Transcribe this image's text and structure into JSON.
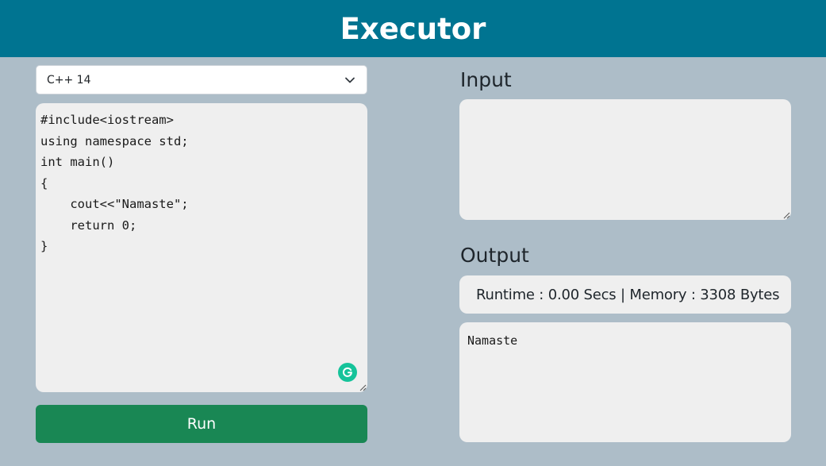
{
  "header": {
    "title": "Executor"
  },
  "language_select": {
    "selected": "C++ 14"
  },
  "code_editor": {
    "value": "#include<iostream>\nusing namespace std;\nint main()\n{\n    cout<<\"Namaste\";\n    return 0;\n}"
  },
  "run_button": {
    "label": "Run"
  },
  "input_section": {
    "title": "Input",
    "value": ""
  },
  "output_section": {
    "title": "Output",
    "stats": "Runtime : 0.00 Secs | Memory : 3308 Bytes",
    "value": "Namaste"
  },
  "icons": {
    "chevron": "chevron-down-icon",
    "grammarly": "grammarly-icon",
    "resize": "resize-grip-icon"
  },
  "colors": {
    "header_bg": "#007491",
    "page_bg": "#adbdc8",
    "run_button_bg": "#198754",
    "panel_bg": "#efefef",
    "grammarly": "#15c39a"
  }
}
